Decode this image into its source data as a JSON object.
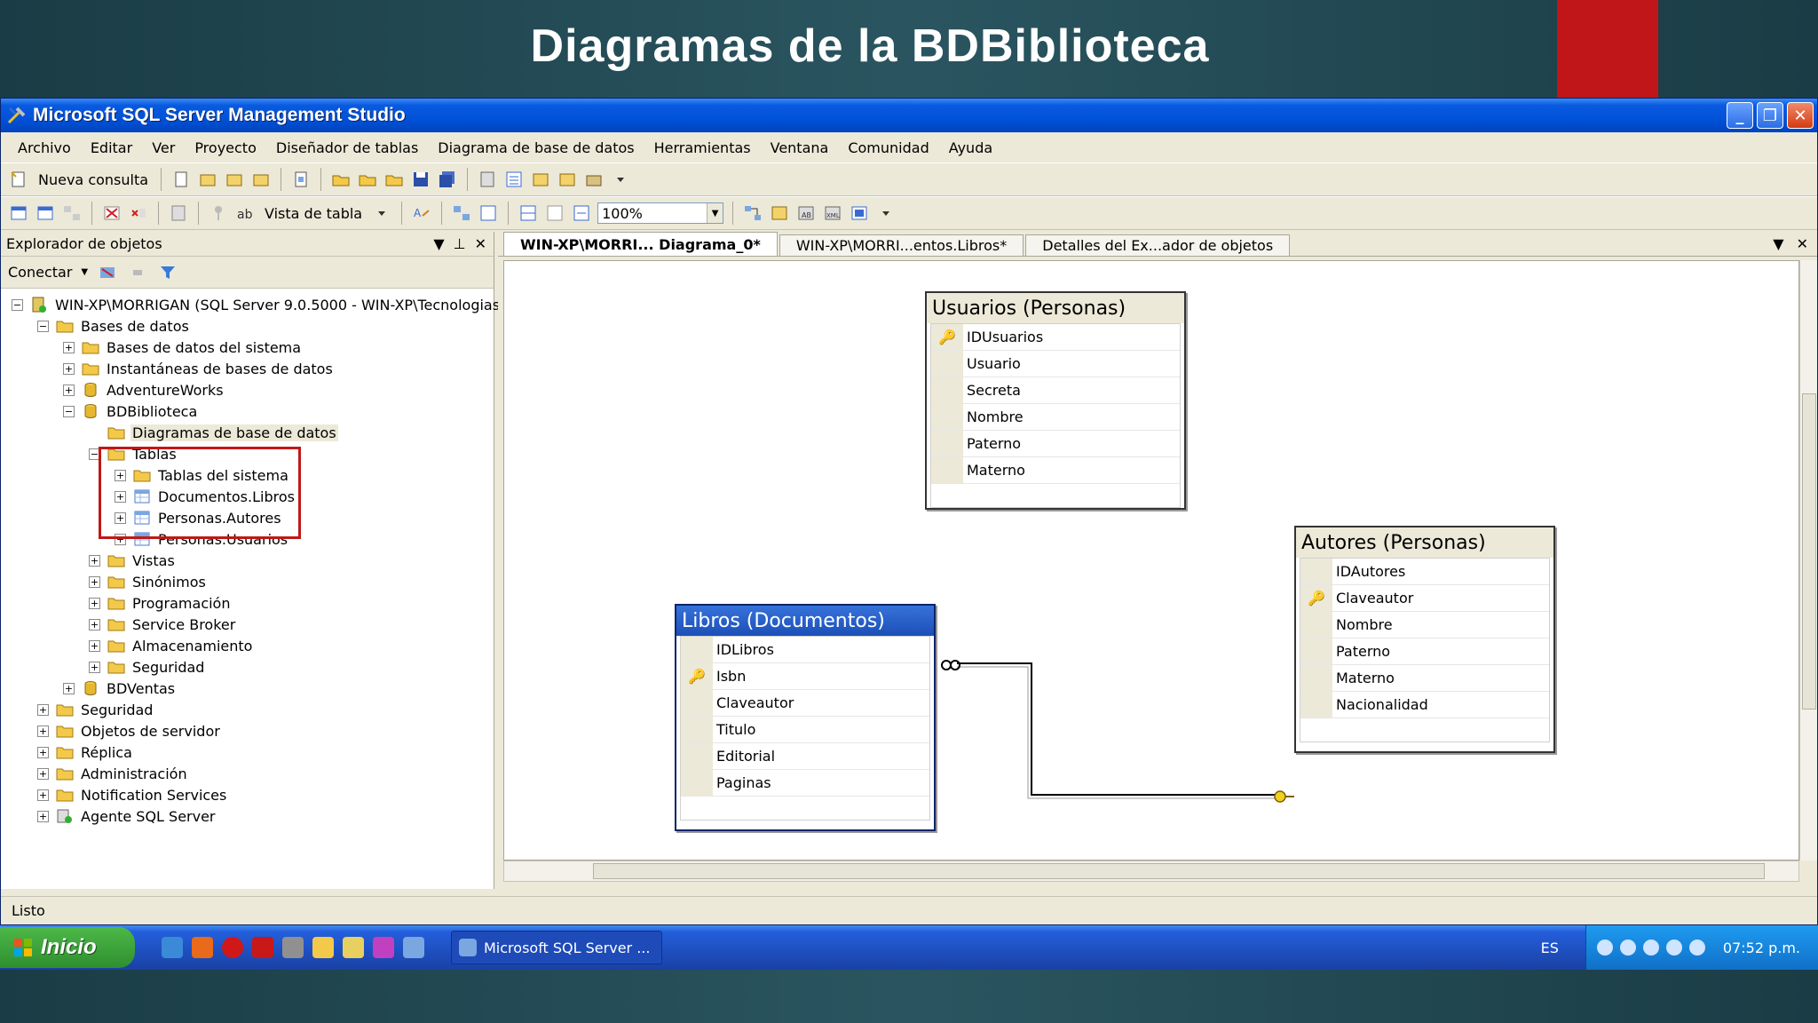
{
  "slide": {
    "title": "Diagramas de la BDBiblioteca"
  },
  "window": {
    "title": "Microsoft SQL Server Management Studio"
  },
  "menu": [
    "Archivo",
    "Editar",
    "Ver",
    "Proyecto",
    "Diseñador de tablas",
    "Diagrama de base de datos",
    "Herramientas",
    "Ventana",
    "Comunidad",
    "Ayuda"
  ],
  "toolbar": {
    "new_query": "Nueva consulta",
    "table_view": "Vista de tabla",
    "zoom": "100%"
  },
  "explorer": {
    "title": "Explorador de objetos",
    "connect": "Conectar",
    "server": "WIN-XP\\MORRIGAN (SQL Server 9.0.5000 - WIN-XP\\Tecnologias)",
    "databases": "Bases de datos",
    "system_dbs": "Bases de datos del sistema",
    "snapshots": "Instantáneas de bases de datos",
    "adventureworks": "AdventureWorks",
    "bdbiblioteca": "BDBiblioteca",
    "diagrams": "Diagramas de base de datos",
    "tables": "Tablas",
    "system_tables": "Tablas del sistema",
    "table_libros": "Documentos.Libros",
    "table_autores": "Personas.Autores",
    "table_usuarios": "Personas.Usuarios",
    "views": "Vistas",
    "synonyms": "Sinónimos",
    "programming": "Programación",
    "service_broker": "Service Broker",
    "storage": "Almacenamiento",
    "db_security": "Seguridad",
    "bdventas": "BDVentas",
    "security": "Seguridad",
    "server_objects": "Objetos de servidor",
    "replication": "Réplica",
    "administration": "Administración",
    "notification": "Notification Services",
    "agent": "Agente SQL Server"
  },
  "tabs": [
    "WIN-XP\\MORRI... Diagrama_0*",
    "WIN-XP\\MORRI...entos.Libros*",
    "Detalles del Ex...ador de objetos"
  ],
  "diagram": {
    "usuarios": {
      "title": "Usuarios (Personas)",
      "columns": [
        "IDUsuarios",
        "Usuario",
        "Secreta",
        "Nombre",
        "Paterno",
        "Materno"
      ]
    },
    "autores": {
      "title": "Autores (Personas)",
      "columns": [
        "IDAutores",
        "Claveautor",
        "Nombre",
        "Paterno",
        "Materno",
        "Nacionalidad"
      ]
    },
    "libros": {
      "title": "Libros (Documentos)",
      "columns": [
        "IDLibros",
        "Isbn",
        "Claveautor",
        "Titulo",
        "Editorial",
        "Paginas"
      ]
    }
  },
  "status": {
    "text": "Listo"
  },
  "taskbar": {
    "start": "Inicio",
    "task": "Microsoft SQL Server ...",
    "lang": "ES",
    "clock": "07:52 p.m."
  },
  "colors": {
    "accent_red": "#c0161a",
    "xp_blue": "#0052d8",
    "selection": "#1c4fb8"
  }
}
